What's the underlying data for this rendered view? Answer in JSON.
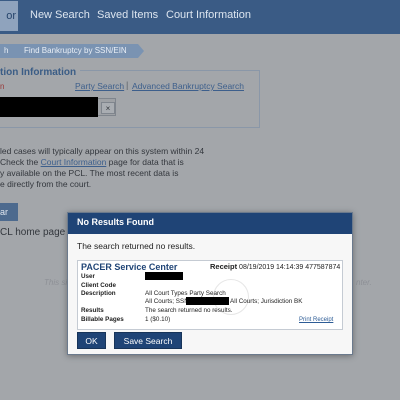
{
  "header": {
    "logo_fragment": "or",
    "nav": [
      "New Search",
      "Saved Items",
      "Court Information"
    ]
  },
  "breadcrumb": {
    "items": [
      "h",
      "Find Bankruptcy by SSN/EIN"
    ]
  },
  "form": {
    "title": "tion Information",
    "label_fragment": "n",
    "party_search_link": "Party Search",
    "separator": "|",
    "advanced_link": "Advanced Bankruptcy Search",
    "clear_symbol": "×"
  },
  "notice": {
    "line1": "led cases will typically appear on this system within 24",
    "line2_pre": "Check the ",
    "line2_link": "Court Information",
    "line2_post": " page for data that is",
    "line3": "y available on the PCL. The most recent data is",
    "line4": "e directly from the court."
  },
  "side_button_fragment": "ar",
  "home_link_fragment": "CL home page",
  "footer": {
    "left_fragment": "This si",
    "right_fragment": "nter."
  },
  "modal": {
    "title": "No Results Found",
    "message": "The search returned no results.",
    "receipt": {
      "title": "PACER Service Center",
      "receipt_label": "Receipt",
      "receipt_value": "08/19/2019 14:14:39 477587874",
      "rows": [
        {
          "key": "User",
          "value": ""
        },
        {
          "key": "Client Code",
          "value": ""
        },
        {
          "key": "Description",
          "value": "All Court Types Party Search"
        },
        {
          "key": "",
          "value": "All Courts; SSN"
        },
        {
          "key": "Results",
          "value": "The search returned no results."
        },
        {
          "key": "Billable Pages",
          "value": "1 ($0.10)"
        }
      ],
      "description_line2_tail": "All Courts; Jurisdiction BK",
      "print_link": "Print Receipt"
    },
    "buttons": {
      "ok": "OK",
      "save": "Save Search"
    }
  },
  "colors": {
    "overlay": "#a3a6aa",
    "header_bar": "#3a5b85",
    "modal_header": "#1f4476",
    "button": "#1f4476"
  }
}
